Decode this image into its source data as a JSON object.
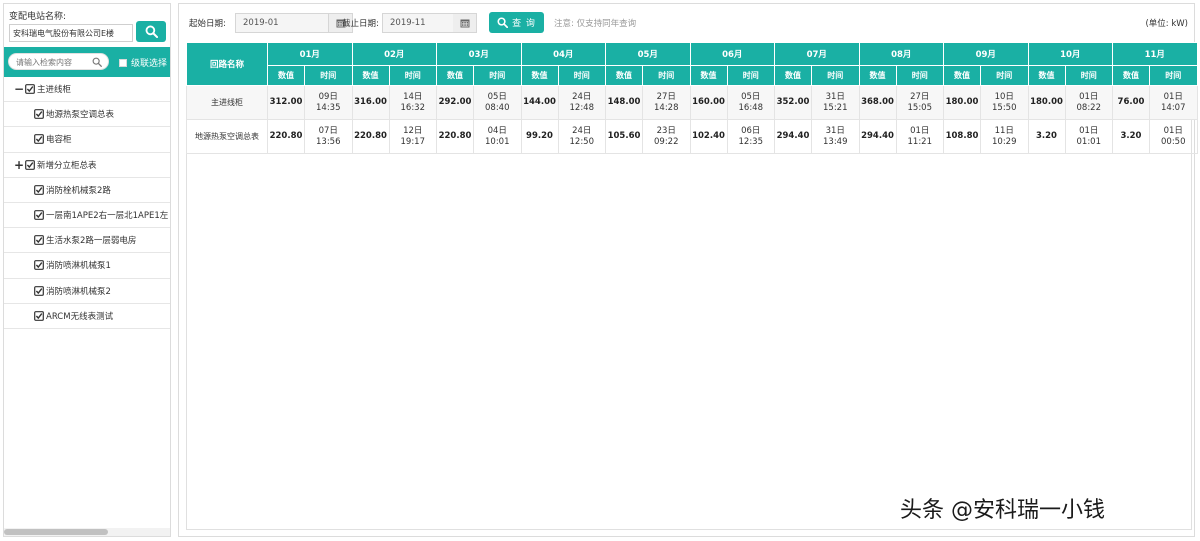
{
  "left_panel": {
    "station_label": "变配电站名称:",
    "station_value": "安科瑞电气股份有限公司E楼",
    "filter_placeholder": "请输入检索内容",
    "cascade_label": "级联选择",
    "tree": [
      {
        "label": "主进线柜",
        "toggle": "−",
        "level": 0
      },
      {
        "label": "地源热泵空调总表",
        "toggle": "",
        "level": 1
      },
      {
        "label": "电容柜",
        "toggle": "",
        "level": 1
      },
      {
        "label": "新增分立柜总表",
        "toggle": "+",
        "level": 0
      },
      {
        "label": "消防栓机械泵2路",
        "toggle": "",
        "level": 1
      },
      {
        "label": "一层南1APE2右一层北1APE1左",
        "toggle": "",
        "level": 1
      },
      {
        "label": "生活水泵2路一层弱电房",
        "toggle": "",
        "level": 1
      },
      {
        "label": "消防喷淋机械泵1",
        "toggle": "",
        "level": 1
      },
      {
        "label": "消防喷淋机械泵2",
        "toggle": "",
        "level": 1
      },
      {
        "label": "ARCM无线表测试",
        "toggle": "",
        "level": 1
      }
    ]
  },
  "toolbar": {
    "start_label": "起始日期:",
    "start_value": "2019-01",
    "end_label": "截止日期:",
    "end_value": "2019-11",
    "query_label": "查 询",
    "note": "注意: 仅支持同年查询",
    "unit": "(单位: kW)"
  },
  "table": {
    "name_header": "回路名称",
    "sub_value": "数值",
    "sub_time": "时间",
    "months": [
      "01月",
      "02月",
      "03月",
      "04月",
      "05月",
      "06月",
      "07月",
      "08月",
      "09月",
      "10月",
      "11月"
    ],
    "rows": [
      {
        "name": "主进线柜",
        "cells": [
          {
            "value": "312.00",
            "day": "09日",
            "time": "14:35"
          },
          {
            "value": "316.00",
            "day": "14日",
            "time": "16:32"
          },
          {
            "value": "292.00",
            "day": "05日",
            "time": "08:40"
          },
          {
            "value": "144.00",
            "day": "24日",
            "time": "12:48"
          },
          {
            "value": "148.00",
            "day": "27日",
            "time": "14:28"
          },
          {
            "value": "160.00",
            "day": "05日",
            "time": "16:48"
          },
          {
            "value": "352.00",
            "day": "31日",
            "time": "15:21"
          },
          {
            "value": "368.00",
            "day": "27日",
            "time": "15:05"
          },
          {
            "value": "180.00",
            "day": "10日",
            "time": "15:50"
          },
          {
            "value": "180.00",
            "day": "01日",
            "time": "08:22"
          },
          {
            "value": "76.00",
            "day": "01日",
            "time": "14:07"
          }
        ]
      },
      {
        "name": "地源热泵空调总表",
        "cells": [
          {
            "value": "220.80",
            "day": "07日",
            "time": "13:56"
          },
          {
            "value": "220.80",
            "day": "12日",
            "time": "19:17"
          },
          {
            "value": "220.80",
            "day": "04日",
            "time": "10:01"
          },
          {
            "value": "99.20",
            "day": "24日",
            "time": "12:50"
          },
          {
            "value": "105.60",
            "day": "23日",
            "time": "09:22"
          },
          {
            "value": "102.40",
            "day": "06日",
            "time": "12:35"
          },
          {
            "value": "294.40",
            "day": "31日",
            "time": "13:49"
          },
          {
            "value": "294.40",
            "day": "01日",
            "time": "11:21"
          },
          {
            "value": "108.80",
            "day": "11日",
            "time": "10:29"
          },
          {
            "value": "3.20",
            "day": "01日",
            "time": "01:01"
          },
          {
            "value": "3.20",
            "day": "01日",
            "time": "00:50"
          }
        ]
      }
    ]
  },
  "watermark": "头条 @安科瑞一小钱",
  "colors": {
    "accent": "#1ab0a4",
    "border": "#dcdcdc"
  }
}
